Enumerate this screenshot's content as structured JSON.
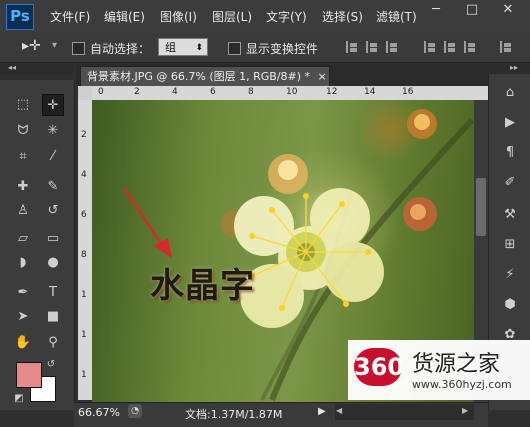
{
  "app": {
    "logo": "Ps"
  },
  "menu": [
    "文件(F)",
    "编辑(E)",
    "图像(I)",
    "图层(L)",
    "文字(Y)",
    "选择(S)",
    "滤镜(T)"
  ],
  "window_controls": {
    "minimize": "─",
    "maximize": "□",
    "close": "✕"
  },
  "options": {
    "auto_select_label": "自动选择：",
    "auto_select_value": "组",
    "show_transform_label": "显示变换控件"
  },
  "document": {
    "tab_title": "背景素材.JPG @ 66.7% (图层 1, RGB/8#) *",
    "close_glyph": "×",
    "canvas_text": "水晶字"
  },
  "rulers": {
    "top": [
      "0",
      "2",
      "4",
      "6",
      "8",
      "10",
      "12",
      "14",
      "16"
    ],
    "left": [
      "2",
      "4",
      "6",
      "8",
      "1",
      "1",
      "1"
    ]
  },
  "status": {
    "zoom": "66.67%",
    "doc_info": "文档:1.37M/1.87M"
  },
  "watermark": {
    "badge": "360",
    "name": "货源之家",
    "url": "www.360hyzj.com"
  },
  "colors": {
    "foreground": "#e58a8a",
    "background": "#ffffff",
    "accent": "#2a78c8",
    "arrow": "#d42a2a"
  }
}
